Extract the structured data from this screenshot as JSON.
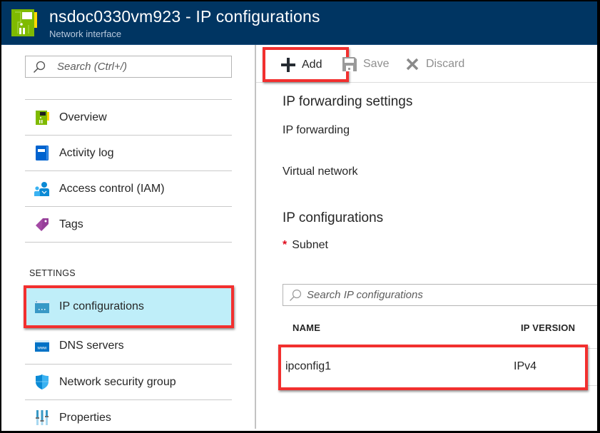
{
  "header": {
    "title": "nsdoc0330vm923 - IP configurations",
    "subtitle": "Network interface",
    "icon": "network-interface-icon"
  },
  "sidebar": {
    "search_placeholder": "Search (Ctrl+/)",
    "items": [
      {
        "label": "Overview",
        "icon": "network-interface-icon"
      },
      {
        "label": "Activity log",
        "icon": "activity-log-icon"
      },
      {
        "label": "Access control (IAM)",
        "icon": "access-control-icon"
      },
      {
        "label": "Tags",
        "icon": "tag-icon"
      }
    ],
    "settings_header": "SETTINGS",
    "settings_items": [
      {
        "label": "IP configurations",
        "icon": "ip-configurations-icon",
        "selected": true
      },
      {
        "label": "DNS servers",
        "icon": "dns-servers-icon"
      },
      {
        "label": "Network security group",
        "icon": "shield-icon"
      },
      {
        "label": "Properties",
        "icon": "properties-icon"
      }
    ]
  },
  "toolbar": {
    "add_label": "Add",
    "save_label": "Save",
    "discard_label": "Discard"
  },
  "main": {
    "ip_forwarding_settings_title": "IP forwarding settings",
    "ip_forwarding_label": "IP forwarding",
    "virtual_network_label": "Virtual network",
    "ip_configurations_title": "IP configurations",
    "subnet_required_marker": "*",
    "subnet_label": "Subnet",
    "search_placeholder": "Search IP configurations",
    "table": {
      "columns": [
        "NAME",
        "IP VERSION"
      ],
      "rows": [
        {
          "name": "ipconfig1",
          "ip_version": "IPv4"
        }
      ]
    }
  },
  "colors": {
    "header_bg": "#003562",
    "highlight_outline": "#f2302f",
    "selected_item_bg": "#bfeef9",
    "required_star": "#e00b1c"
  }
}
